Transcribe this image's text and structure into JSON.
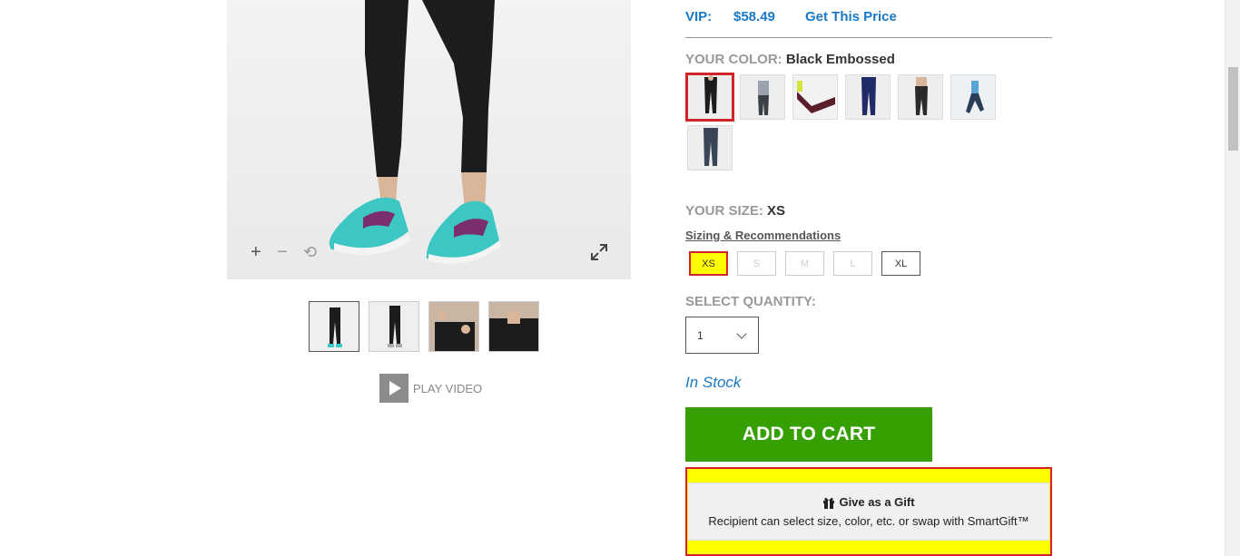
{
  "pricing": {
    "vip_label": "VIP:",
    "vip_price": "$58.49",
    "get_price_link": "Get This Price"
  },
  "color": {
    "label": "YOUR COLOR:",
    "selected": "Black Embossed",
    "swatch_count": 7,
    "selected_index": 0
  },
  "size": {
    "label": "YOUR SIZE:",
    "selected": "XS",
    "sizing_link": "Sizing & Recommendations",
    "options": [
      {
        "label": "XS",
        "state": "selected"
      },
      {
        "label": "S",
        "state": "unavailable"
      },
      {
        "label": "M",
        "state": "unavailable"
      },
      {
        "label": "L",
        "state": "unavailable"
      },
      {
        "label": "XL",
        "state": "available"
      }
    ]
  },
  "quantity": {
    "label": "SELECT QUANTITY:",
    "value": "1"
  },
  "stock_status": "In Stock",
  "add_to_cart": "ADD TO CART",
  "gift": {
    "title": "Give as a Gift",
    "subtitle": "Recipient can select size, color, etc. or swap with SmartGift™"
  },
  "media": {
    "zoom_in_icon": "plus-icon",
    "zoom_out_icon": "minus-icon",
    "reset_icon": "rotate-icon",
    "fullscreen_icon": "expand-icon",
    "thumbnail_count": 4,
    "play_video_label": "PLAY VIDEO"
  },
  "colors": {
    "link_blue": "#1a79c6",
    "cart_green": "#36a003",
    "highlight_yellow": "#ffff00",
    "highlight_red": "#d2232a"
  }
}
